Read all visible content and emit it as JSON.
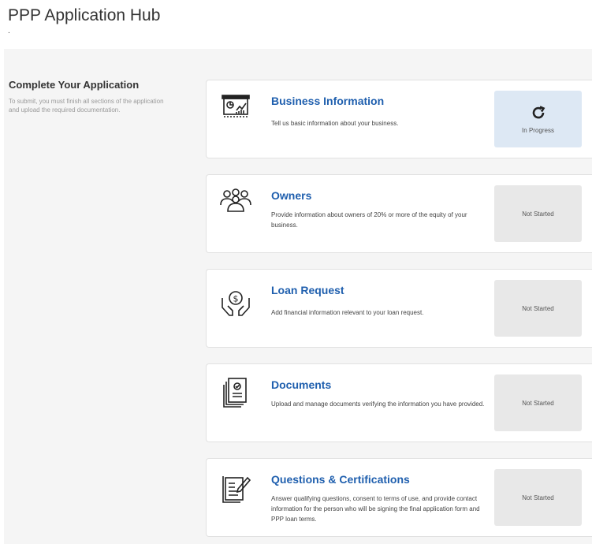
{
  "header": {
    "title": "PPP Application Hub",
    "dot": "."
  },
  "intro": {
    "heading": "Complete Your Application",
    "text": "To submit, you must finish all sections of the application and upload the required documentation."
  },
  "sections": [
    {
      "title": "Business Information",
      "description": "Tell us basic information about your business.",
      "status": "In Progress",
      "icon": "presentation-chart-icon"
    },
    {
      "title": "Owners",
      "description": "Provide information about owners of 20% or more of the equity of your business.",
      "status": "Not Started",
      "icon": "people-group-icon"
    },
    {
      "title": "Loan Request",
      "description": "Add financial information relevant to your loan request.",
      "status": "Not Started",
      "icon": "money-hands-icon"
    },
    {
      "title": "Documents",
      "description": "Upload and manage documents verifying the information you have provided.",
      "status": "Not Started",
      "icon": "document-stack-icon"
    },
    {
      "title": "Questions & Certifications",
      "description": "Answer qualifying questions, consent to terms of use, and provide contact information for the person who will be signing the final application form and PPP loan terms.",
      "status": "Not Started",
      "icon": "certification-edit-icon"
    }
  ],
  "colors": {
    "title_blue": "#1f5fae",
    "in_progress_bg": "#dde8f4",
    "not_started_bg": "#e8e8e8"
  }
}
